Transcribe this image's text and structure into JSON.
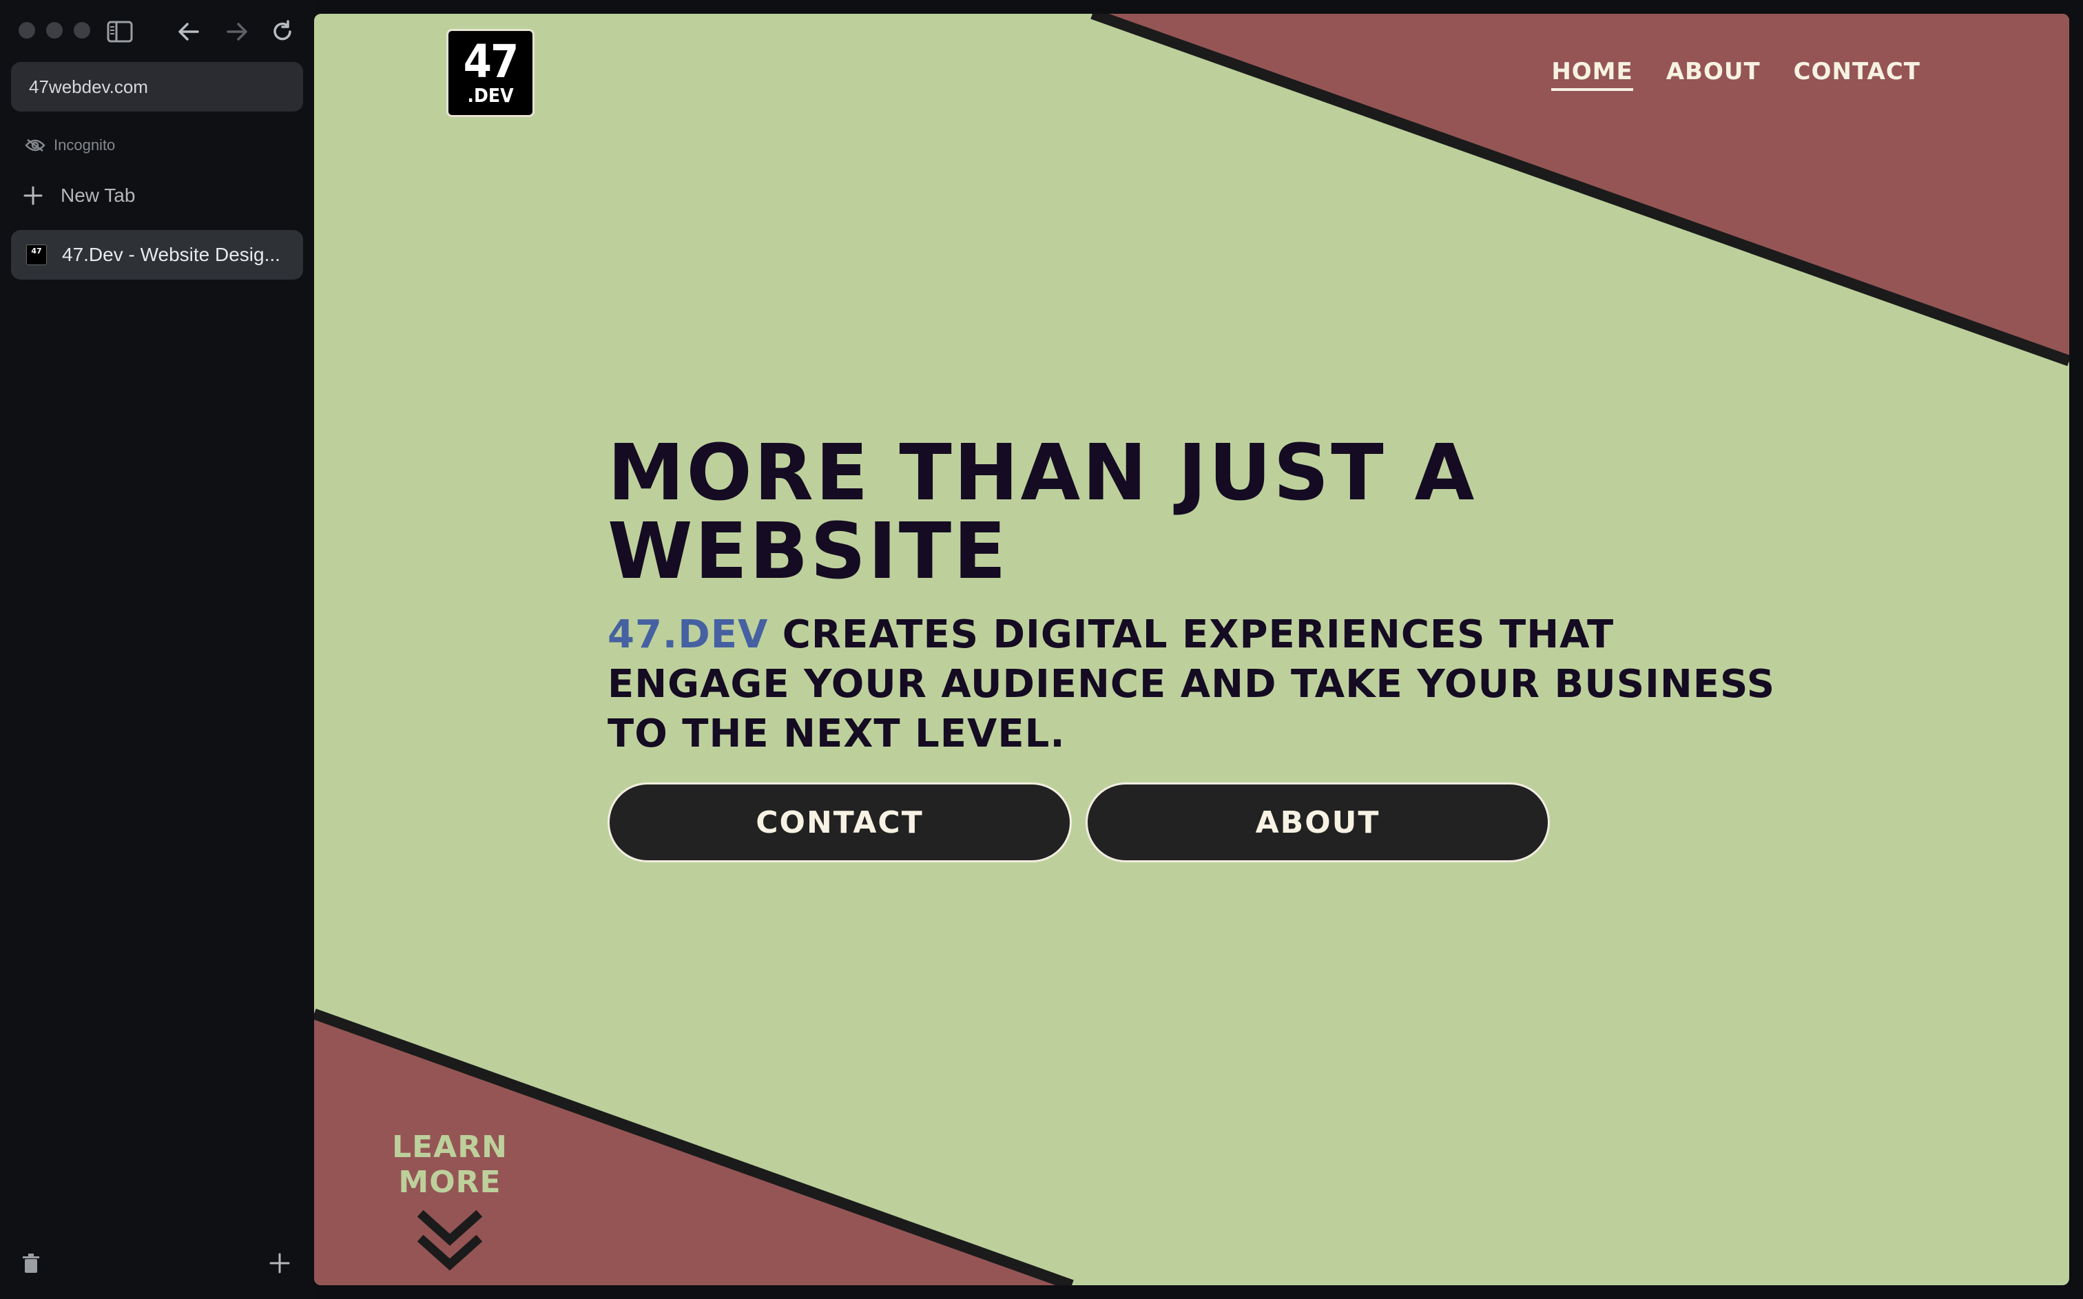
{
  "browser": {
    "address": "47webdev.com",
    "incognito_label": "Incognito",
    "new_tab_label": "New Tab",
    "active_tab_title": "47.Dev - Website Desig...",
    "favicon_text": "47"
  },
  "site": {
    "logo": {
      "number": "47",
      "suffix": ".DEV"
    },
    "nav": {
      "home": "HOME",
      "about": "ABOUT",
      "contact": "CONTACT",
      "active": "home"
    },
    "hero": {
      "title": "MORE THAN JUST A WEBSITE",
      "brand": "47.DEV",
      "subtitle": " CREATES DIGITAL EXPERIENCES THAT ENGAGE YOUR AUDIENCE AND TAKE YOUR BUSINESS TO THE NEXT LEVEL."
    },
    "buttons": {
      "contact": "CONTACT",
      "about": "ABOUT"
    },
    "learn_more": "LEARN MORE"
  },
  "colors": {
    "background_green": "#bdd09c",
    "accent_red": "#955555",
    "dark_text": "#150b22",
    "brand_blue": "#4661a1",
    "button_dark": "#222222"
  },
  "icons": [
    "sidebar-toggle-icon",
    "back-arrow-icon",
    "forward-arrow-icon",
    "reload-icon",
    "incognito-eye-icon",
    "plus-icon",
    "trash-icon",
    "chevron-double-down-icon"
  ]
}
